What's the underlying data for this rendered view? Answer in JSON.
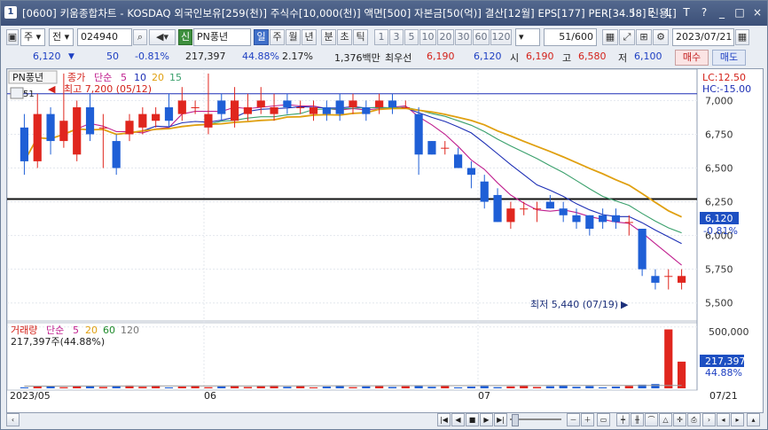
{
  "window": {
    "app_number": "1",
    "title": "[0600] 키움종합차트 - KOSDAQ 외국인보유[259(천)] 주식수[10,000(천)] 액면[500] 자본금[50(억)] 결산[12월] EPS[177] PER[34.58] 신용[]",
    "buttons": [
      "I",
      "E",
      "L",
      "T",
      "?",
      "_",
      "□",
      "×"
    ]
  },
  "toolbar": {
    "stock_type": "주",
    "stock_prefix": "전",
    "stock_code": "024940",
    "stock_name": "PN풍년",
    "stock_tag": "신",
    "period_buttons": [
      "일",
      "주",
      "월",
      "년",
      "분",
      "초",
      "틱"
    ],
    "active_period": "일",
    "interval_buttons": [
      "1",
      "3",
      "5",
      "10",
      "20",
      "30",
      "60",
      "120"
    ],
    "count": "51",
    "count_total": "/600",
    "date": "2023/07/21"
  },
  "quote": {
    "price": "6,120",
    "down_arrow": "▼",
    "change": "50",
    "change_pct": "-0.81%",
    "volume": "217,397",
    "volume_ratio": "44.88%",
    "turnover": "2.17%",
    "amount": "1,376백만",
    "best_ask_label": "최우선",
    "best_ask": "6,190",
    "best_bid": "6,120",
    "open_label": "시",
    "open": "6,190",
    "high_label": "고",
    "high": "6,580",
    "low_label": "저",
    "low": "6,100",
    "buy_label": "매수",
    "sell_label": "매도"
  },
  "chart_data": [
    {
      "type": "candlestick",
      "name": "PN풍년",
      "legend": [
        "종가",
        "단순",
        "5",
        "10",
        "20",
        "15"
      ],
      "legend_colors": [
        "#d3221a",
        "#c0208f",
        "#1d2fb5",
        "#1d8a2a",
        "#e0a010",
        "#3aa06c"
      ],
      "candles": [
        {
          "o": 6800,
          "h": 6900,
          "l": 6450,
          "c": 6550
        },
        {
          "o": 6550,
          "h": 7050,
          "l": 6500,
          "c": 6900
        },
        {
          "o": 6900,
          "h": 6950,
          "l": 6600,
          "c": 6700
        },
        {
          "o": 6700,
          "h": 7200,
          "l": 6650,
          "c": 6850
        },
        {
          "o": 6600,
          "h": 7000,
          "l": 6550,
          "c": 6950
        },
        {
          "o": 6950,
          "h": 7050,
          "l": 6700,
          "c": 6750
        },
        {
          "o": 6800,
          "h": 6900,
          "l": 6500,
          "c": 6800
        },
        {
          "o": 6700,
          "h": 6750,
          "l": 6450,
          "c": 6500
        },
        {
          "o": 6750,
          "h": 6900,
          "l": 6700,
          "c": 6850
        },
        {
          "o": 6800,
          "h": 6950,
          "l": 6750,
          "c": 6900
        },
        {
          "o": 6850,
          "h": 6950,
          "l": 6800,
          "c": 6900
        },
        {
          "o": 6950,
          "h": 7050,
          "l": 6800,
          "c": 6850
        },
        {
          "o": 6900,
          "h": 7100,
          "l": 6850,
          "c": 7000
        },
        {
          "o": 6950,
          "h": 7000,
          "l": 6900,
          "c": 6950
        },
        {
          "o": 6800,
          "h": 7200,
          "l": 6750,
          "c": 6900
        },
        {
          "o": 7000,
          "h": 7050,
          "l": 6850,
          "c": 6900
        },
        {
          "o": 6850,
          "h": 7100,
          "l": 6800,
          "c": 7000
        },
        {
          "o": 6900,
          "h": 7050,
          "l": 6850,
          "c": 6950
        },
        {
          "o": 6950,
          "h": 7100,
          "l": 6900,
          "c": 7000
        },
        {
          "o": 6900,
          "h": 7050,
          "l": 6850,
          "c": 6950
        },
        {
          "o": 7000,
          "h": 7050,
          "l": 6900,
          "c": 6950
        },
        {
          "o": 6950,
          "h": 7000,
          "l": 6900,
          "c": 6950
        },
        {
          "o": 6900,
          "h": 7000,
          "l": 6850,
          "c": 6950
        },
        {
          "o": 6950,
          "h": 7000,
          "l": 6850,
          "c": 6900
        },
        {
          "o": 7000,
          "h": 7050,
          "l": 6850,
          "c": 6900
        },
        {
          "o": 6950,
          "h": 7050,
          "l": 6900,
          "c": 7000
        },
        {
          "o": 6950,
          "h": 7000,
          "l": 6850,
          "c": 6900
        },
        {
          "o": 6950,
          "h": 7050,
          "l": 6900,
          "c": 7000
        },
        {
          "o": 7000,
          "h": 7050,
          "l": 6900,
          "c": 6950
        },
        {
          "o": 6950,
          "h": 7000,
          "l": 6950,
          "c": 6950
        },
        {
          "o": 6900,
          "h": 6950,
          "l": 6450,
          "c": 6600
        },
        {
          "o": 6700,
          "h": 6700,
          "l": 6600,
          "c": 6600
        },
        {
          "o": 6650,
          "h": 6700,
          "l": 6600,
          "c": 6650
        },
        {
          "o": 6600,
          "h": 6650,
          "l": 6500,
          "c": 6500
        },
        {
          "o": 6500,
          "h": 6550,
          "l": 6350,
          "c": 6450
        },
        {
          "o": 6400,
          "h": 6450,
          "l": 6200,
          "c": 6250
        },
        {
          "o": 6300,
          "h": 6350,
          "l": 6100,
          "c": 6100
        },
        {
          "o": 6100,
          "h": 6250,
          "l": 6050,
          "c": 6200
        },
        {
          "o": 6200,
          "h": 6250,
          "l": 6150,
          "c": 6200
        },
        {
          "o": 6200,
          "h": 6250,
          "l": 6100,
          "c": 6200
        },
        {
          "o": 6250,
          "h": 6300,
          "l": 6200,
          "c": 6200
        },
        {
          "o": 6200,
          "h": 6250,
          "l": 6100,
          "c": 6150
        },
        {
          "o": 6150,
          "h": 6200,
          "l": 6050,
          "c": 6100
        },
        {
          "o": 6150,
          "h": 6150,
          "l": 6000,
          "c": 6050
        },
        {
          "o": 6150,
          "h": 6200,
          "l": 6050,
          "c": 6100
        },
        {
          "o": 6150,
          "h": 6200,
          "l": 6050,
          "c": 6100
        },
        {
          "o": 6100,
          "h": 6150,
          "l": 6000,
          "c": 6100
        },
        {
          "o": 6050,
          "h": 6050,
          "l": 5700,
          "c": 5750
        },
        {
          "o": 5700,
          "h": 5750,
          "l": 5600,
          "c": 5650
        },
        {
          "o": 5700,
          "h": 5750,
          "l": 5600,
          "c": 5700
        },
        {
          "o": 5650,
          "h": 5750,
          "l": 5600,
          "c": 5700
        }
      ],
      "annotations": {
        "high_label": "최고 7,200 (05/12)",
        "low_label": "최저 5,440 (07/19)",
        "lc": "LC:12.50",
        "hc": "HC:-15.00",
        "icon_label": "51",
        "last_price_label": "6,120",
        "last_change_label": "-0.81%",
        "legend_stock": "PN풍년"
      },
      "y_ticks": [
        "7,000",
        "6,750",
        "6,500",
        "6,250",
        "6,000",
        "5,750",
        "5,500"
      ],
      "y_values": [
        7000,
        6750,
        6500,
        6250,
        6000,
        5750,
        5500
      ],
      "ylim": [
        5380,
        7180
      ],
      "reference_lines": [
        7050,
        6270
      ],
      "grid": true
    },
    {
      "type": "bar",
      "name": "거래량",
      "legend": [
        "거래량",
        "단순",
        "5",
        "20",
        "60",
        "120"
      ],
      "legend_colors": [
        "#d3221a",
        "#c0208f",
        "#c0208f",
        "#e0a010",
        "#1d8a2a",
        "#777777"
      ],
      "info_label": "217,397주(44.88%)",
      "y_ticks": [
        "500,000"
      ],
      "last_value_label": "217,397",
      "last_pct_label": "44.88%",
      "ylim": [
        0,
        520000
      ],
      "x_labels": [
        "2023/05",
        "06",
        "07",
        "07/21"
      ]
    }
  ],
  "bottombar": {
    "nav": [
      "|◀",
      "◀",
      "■",
      "▶",
      "▶|"
    ]
  }
}
